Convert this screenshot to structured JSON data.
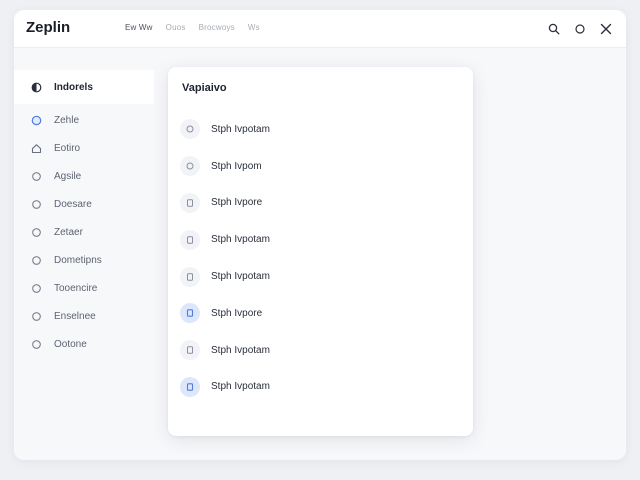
{
  "app": {
    "title": "Zeplin"
  },
  "topnav": {
    "items": [
      "Ew Ww",
      "Ouos",
      "Brocwoys",
      "Ws"
    ]
  },
  "topbar_icons": [
    "search-icon",
    "circle-icon",
    "close-icon"
  ],
  "sidebar": {
    "items": [
      {
        "label": "Indorels",
        "icon": "half-circle-icon",
        "active": true
      },
      {
        "label": "Zehle",
        "icon": "round-icon"
      },
      {
        "label": "Eotiro",
        "icon": "house-icon"
      },
      {
        "label": "Agsile",
        "icon": "circle-icon"
      },
      {
        "label": "Doesare",
        "icon": "circle-icon"
      },
      {
        "label": "Zetaer",
        "icon": "circle-icon"
      },
      {
        "label": "Dometipns",
        "icon": "circle-icon"
      },
      {
        "label": "Tooencire",
        "icon": "circle-icon"
      },
      {
        "label": "Enselnee",
        "icon": "circle-icon"
      },
      {
        "label": "Ootone",
        "icon": "circle-icon"
      }
    ]
  },
  "panel": {
    "title": "Vapiaivo",
    "items": [
      {
        "label": "Stph Ivpotam",
        "icon": "circle-icon",
        "highlight": false
      },
      {
        "label": "Stph Ivpom",
        "icon": "circle-icon",
        "highlight": false
      },
      {
        "label": "Stph Ivpore",
        "icon": "page-icon",
        "highlight": false
      },
      {
        "label": "Stph Ivpotam",
        "icon": "page-icon",
        "highlight": false
      },
      {
        "label": "Stph Ivpotam",
        "icon": "page-icon",
        "highlight": false
      },
      {
        "label": "Stph Ivpore",
        "icon": "page-icon",
        "highlight": true
      },
      {
        "label": "Stph Ivpotam",
        "icon": "page-icon",
        "highlight": false
      },
      {
        "label": "Stph Ivpotam",
        "icon": "page-icon",
        "highlight": true
      }
    ]
  },
  "colors": {
    "accent": "#4f7de0",
    "highlight_bg": "#dde7fb",
    "background": "#eef0f4"
  }
}
